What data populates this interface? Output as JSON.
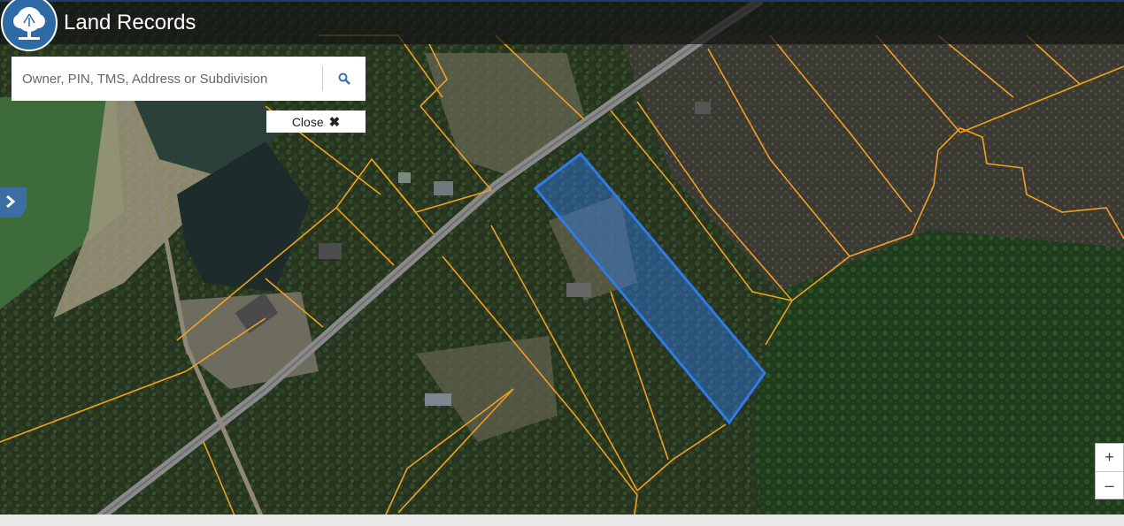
{
  "header": {
    "title": "Land Records",
    "logo_icon": "tree-icon"
  },
  "search": {
    "placeholder": "Owner, PIN, TMS, Address or Subdivision",
    "value": "",
    "button_icon": "search-icon"
  },
  "close_button": {
    "label": "Close",
    "icon": "close-icon",
    "glyph": "✖"
  },
  "sidebar_toggle": {
    "icon": "chevron-right-icon"
  },
  "zoom": {
    "in_label": "+",
    "out_label": "–"
  },
  "map": {
    "parcel_line_color": "#f0a020",
    "selected_parcel_color": "#2f7be8",
    "road_color": "#8a8a8a"
  }
}
